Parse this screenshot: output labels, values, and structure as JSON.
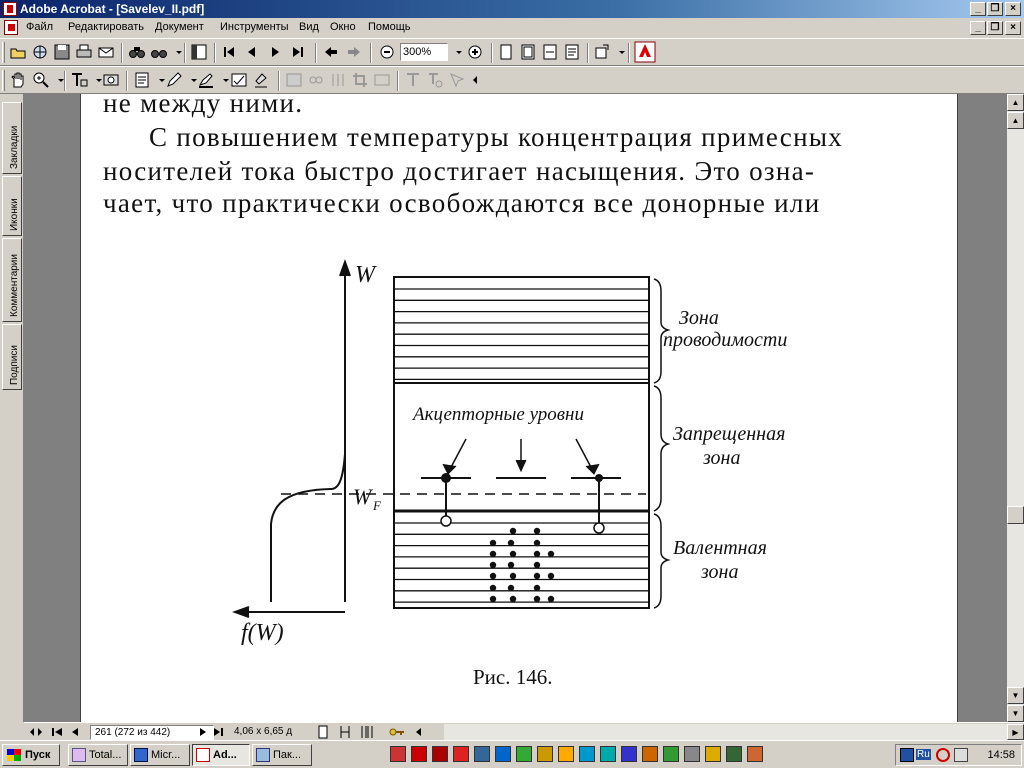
{
  "window": {
    "title": "Adobe Acrobat - [Savelev_II.pdf]"
  },
  "menu": [
    "Файл",
    "Редактировать",
    "Документ",
    "Инструменты",
    "Вид",
    "Окно",
    "Помощь"
  ],
  "toolbar": {
    "zoom_value": "300%",
    "adobe_logo_text": "Adobe"
  },
  "side_tabs": [
    "Закладки",
    "Иконки",
    "Комментарии",
    "Подписи"
  ],
  "document": {
    "lines": [
      "не между ними.",
      "С повышением температуры концентрация примесных",
      "носителей тока быстро достигает насыщения. Это озна-",
      "чает, что практически освобождаются все донорные или"
    ],
    "figure": {
      "axis_w": "W",
      "axis_f": "f(W)",
      "fermi_main": "W",
      "fermi_sub": "F",
      "zone_conduction_1": "Зона",
      "zone_conduction_2": "проводимости",
      "zone_forbidden_1": "Запрещенная",
      "zone_forbidden_2": "зона",
      "zone_valence_1": "Валентная",
      "zone_valence_2": "зона",
      "acceptor_label": "Акцепторные уровни",
      "caption": "Рис. 146."
    }
  },
  "status": {
    "page_info": "261  (272 из 442)",
    "page_size": "4,06 x 6,65 д"
  },
  "taskbar": {
    "start": "Пуск",
    "tasks": [
      "Total...",
      "Micr...",
      "Ad...",
      "Пак..."
    ],
    "tray_lang": "Ru",
    "clock": "14:58"
  }
}
